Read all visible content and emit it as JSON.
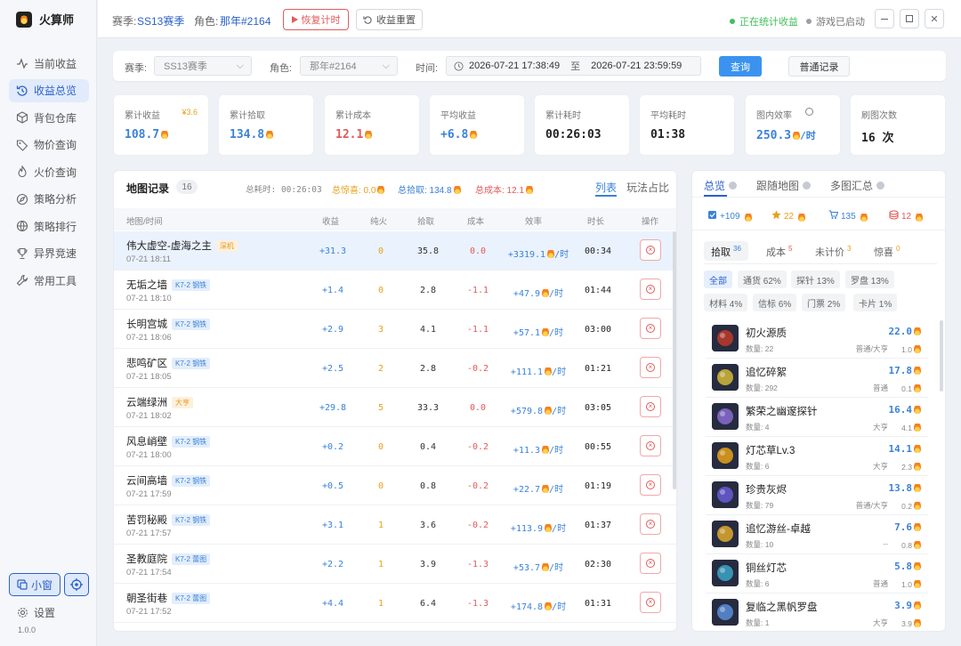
{
  "app": {
    "name": "火算师",
    "version": "1.0.0"
  },
  "sidebar": {
    "items": [
      {
        "label": "当前收益",
        "icon": "pulse-icon",
        "active": false
      },
      {
        "label": "收益总览",
        "icon": "history-icon",
        "active": true
      },
      {
        "label": "背包仓库",
        "icon": "package-icon",
        "active": false
      },
      {
        "label": "物价查询",
        "icon": "tag-icon",
        "active": false
      },
      {
        "label": "火价查询",
        "icon": "flame-icon",
        "active": false
      },
      {
        "label": "策略分析",
        "icon": "compass-icon",
        "active": false
      },
      {
        "label": "策略排行",
        "icon": "globe-icon",
        "active": false
      },
      {
        "label": "异界竞速",
        "icon": "trophy-icon",
        "active": false
      },
      {
        "label": "常用工具",
        "icon": "wrench-icon",
        "active": false
      }
    ],
    "mini_label": "小窗",
    "settings_label": "设置"
  },
  "header": {
    "season_label": "赛季:",
    "season_value": "SS13赛季",
    "role_label": "角色:",
    "role_value": "那年#2164",
    "resume_label": "恢复计时",
    "reset_label": "收益重置",
    "status_stats": "正在统计收益",
    "status_game": "游戏已启动",
    "colors": {
      "stats": "#3fbf5a",
      "game": "#9aa0a8"
    }
  },
  "filter": {
    "season_label": "赛季:",
    "season_value": "SS13赛季",
    "role_label": "角色:",
    "role_value": "那年#2164",
    "time_label": "时间:",
    "start": "2026-07-21 17:38:49",
    "to": "至",
    "end": "2026-07-21 23:59:59",
    "query_label": "查询",
    "normal_label": "普通记录"
  },
  "cards": [
    {
      "label": "累计收益",
      "extra": "¥3.6",
      "value": "108.7",
      "color": "#3b82d8",
      "flame": true
    },
    {
      "label": "累计拾取",
      "extra": "",
      "value": "134.8",
      "color": "#3b82d8",
      "flame": true
    },
    {
      "label": "累计成本",
      "extra": "",
      "value": "12.1",
      "color": "#e35a5a",
      "flame": true
    },
    {
      "label": "平均收益",
      "extra": "",
      "value": "+6.8",
      "color": "#3b82d8",
      "flame": true
    },
    {
      "label": "累计耗时",
      "extra": "",
      "value": "00:26:03",
      "color": "#222",
      "flame": false
    },
    {
      "label": "平均耗时",
      "extra": "",
      "value": "01:38",
      "color": "#222",
      "flame": false
    },
    {
      "label": "图内效率",
      "extra": "",
      "value": "250.3",
      "unit": "/时",
      "color": "#3b82d8",
      "flame": true
    },
    {
      "label": "刷图次数",
      "extra": "",
      "value": "16 次",
      "color": "#222",
      "flame": false
    }
  ],
  "maps": {
    "title": "地图记录",
    "count": "16",
    "total_time": "总耗时: 00:26:03",
    "total_surprise": "总惊喜: 0.0",
    "total_pick": "总拾取: 134.8",
    "total_cost": "总成本: 12.1",
    "tab_list": "列表",
    "tab_ratio": "玩法占比",
    "columns": [
      "地图/时间",
      "收益",
      "纯火",
      "拾取",
      "成本",
      "效率",
      "时长",
      "操作"
    ],
    "rows": [
      {
        "name": "伟大虚空-虚海之主",
        "tag": "深机",
        "tag_color": "orange",
        "time": "07-21 18:11",
        "profit": "+31.3",
        "pure": "0",
        "pick": "35.8",
        "cost": "0.0",
        "eff": "+3319.1",
        "dur": "00:34",
        "selected": true
      },
      {
        "name": "无垢之墙",
        "tag": "K7-2 钢铁",
        "tag_color": "blue",
        "time": "07-21 18:10",
        "profit": "+1.4",
        "pure": "0",
        "pick": "2.8",
        "cost": "-1.1",
        "eff": "+47.9",
        "dur": "01:44"
      },
      {
        "name": "长明宫城",
        "tag": "K7-2 钢铁",
        "tag_color": "blue",
        "time": "07-21 18:06",
        "profit": "+2.9",
        "pure": "3",
        "pick": "4.1",
        "cost": "-1.1",
        "eff": "+57.1",
        "dur": "03:00"
      },
      {
        "name": "悲鸣矿区",
        "tag": "K7-2 钢铁",
        "tag_color": "blue",
        "time": "07-21 18:05",
        "profit": "+2.5",
        "pure": "2",
        "pick": "2.8",
        "cost": "-0.2",
        "eff": "+111.1",
        "dur": "01:21"
      },
      {
        "name": "云端绿洲",
        "tag": "大亨",
        "tag_color": "orange",
        "time": "07-21 18:02",
        "profit": "+29.8",
        "pure": "5",
        "pick": "33.3",
        "cost": "0.0",
        "eff": "+579.8",
        "dur": "03:05"
      },
      {
        "name": "风息峭壁",
        "tag": "K7-2 钢铁",
        "tag_color": "blue",
        "time": "07-21 18:00",
        "profit": "+0.2",
        "pure": "0",
        "pick": "0.4",
        "cost": "-0.2",
        "eff": "+11.3",
        "dur": "00:55"
      },
      {
        "name": "云间高墙",
        "tag": "K7-2 钢铁",
        "tag_color": "blue",
        "time": "07-21 17:59",
        "profit": "+0.5",
        "pure": "0",
        "pick": "0.8",
        "cost": "-0.2",
        "eff": "+22.7",
        "dur": "01:19"
      },
      {
        "name": "苦罚秘殿",
        "tag": "K7-2 钢铁",
        "tag_color": "blue",
        "time": "07-21 17:57",
        "profit": "+3.1",
        "pure": "1",
        "pick": "3.6",
        "cost": "-0.2",
        "eff": "+113.9",
        "dur": "01:37"
      },
      {
        "name": "圣教庭院",
        "tag": "K7-2 蕾图",
        "tag_color": "blue",
        "time": "07-21 17:54",
        "profit": "+2.2",
        "pure": "1",
        "pick": "3.9",
        "cost": "-1.3",
        "eff": "+53.7",
        "dur": "02:30"
      },
      {
        "name": "朝圣街巷",
        "tag": "K7-2 蕾图",
        "tag_color": "blue",
        "time": "07-21 17:52",
        "profit": "+4.4",
        "pure": "1",
        "pick": "6.4",
        "cost": "-1.3",
        "eff": "+174.8",
        "dur": "01:31"
      }
    ],
    "eff_unit": "/时"
  },
  "right": {
    "tabs": [
      "总览",
      "跟随地图",
      "多图汇总"
    ],
    "stats": [
      {
        "icon": "check-icon",
        "value": "+109",
        "color": "#3b82d8"
      },
      {
        "icon": "star-icon",
        "value": "22",
        "color": "#e8a11a"
      },
      {
        "icon": "cart-icon",
        "value": "135",
        "color": "#3b82d8"
      },
      {
        "icon": "coin-icon",
        "value": "12",
        "color": "#e35a5a"
      }
    ],
    "subtabs": [
      {
        "label": "拾取",
        "count": "36",
        "color": "#3b82d8",
        "active": true
      },
      {
        "label": "成本",
        "count": "5",
        "color": "#e35a5a"
      },
      {
        "label": "未计价",
        "count": "3",
        "color": "#e8a11a"
      },
      {
        "label": "惊喜",
        "count": "0",
        "color": "#e8a11a"
      }
    ],
    "chips": [
      "全部",
      "通货 62%",
      "探针 13%",
      "罗盘 13%",
      "材料 4%",
      "信标 6%",
      "门票 2%",
      "卡片 1%"
    ],
    "items": [
      {
        "name": "初火源质",
        "qty": "数量: 22",
        "type": "普通/大亨",
        "value": "22.0",
        "sub": "1.0",
        "icon": "crystal-icon",
        "tint": "#c0392b"
      },
      {
        "name": "追忆碎絮",
        "qty": "数量: 292",
        "type": "普通",
        "value": "17.8",
        "sub": "0.1",
        "icon": "feather-icon",
        "tint": "#d4b83a"
      },
      {
        "name": "繁荣之幽邃探针",
        "qty": "数量: 4",
        "type": "大亨",
        "value": "16.4",
        "sub": "4.1",
        "icon": "probe-icon",
        "tint": "#8a6bd1"
      },
      {
        "name": "灯芯草Lv.3",
        "qty": "数量: 6",
        "type": "大亨",
        "value": "14.1",
        "sub": "2.3",
        "icon": "wick-icon",
        "tint": "#e8a11a"
      },
      {
        "name": "珍贵灰烬",
        "qty": "数量: 79",
        "type": "普通/大亨",
        "value": "13.8",
        "sub": "0.2",
        "icon": "ash-icon",
        "tint": "#6a5bd6"
      },
      {
        "name": "追忆游丝-卓越",
        "qty": "数量: 10",
        "type": "--",
        "value": "7.6",
        "sub": "0.8",
        "icon": "thread-icon",
        "tint": "#e0a92e"
      },
      {
        "name": "铜丝灯芯",
        "qty": "数量: 6",
        "type": "普通",
        "value": "5.8",
        "sub": "1.0",
        "icon": "lamp-icon",
        "tint": "#3aa6c9"
      },
      {
        "name": "复临之黑帆罗盘",
        "qty": "数量: 1",
        "type": "大亨",
        "value": "3.9",
        "sub": "3.9",
        "icon": "compass-item-icon",
        "tint": "#5b8ed8"
      }
    ]
  }
}
